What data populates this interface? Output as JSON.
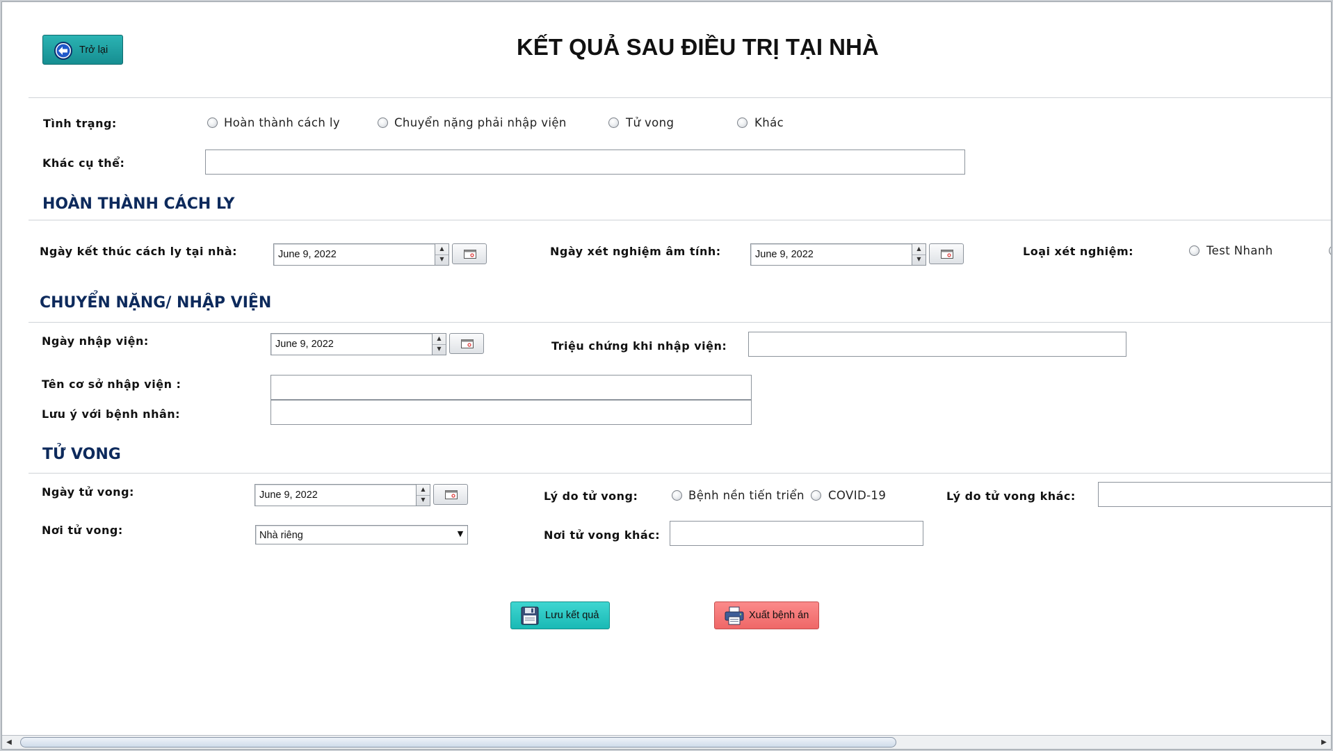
{
  "header": {
    "back_button": "Trở lại",
    "title": "KẾT QUẢ SAU ĐIỀU TRỊ TẠI NHÀ"
  },
  "status": {
    "label": "Tình trạng:",
    "options": [
      "Hoàn thành cách ly",
      "Chuyển nặng phải nhập viện",
      "Tử vong",
      "Khác"
    ],
    "other_label": "Khác cụ thể:",
    "other_value": ""
  },
  "quarantine": {
    "heading": "HOÀN THÀNH CÁCH LY",
    "end_date_label": "Ngày kết thúc cách ly tại nhà:",
    "end_date": "June 9, 2022",
    "negative_date_label": "Ngày xét nghiệm âm tính:",
    "negative_date": "June 9, 2022",
    "test_type_label": "Loại xét nghiệm:",
    "test_options": [
      "Test Nhanh"
    ]
  },
  "hospital": {
    "heading": "CHUYỂN NẶNG/ NHẬP VIỆN",
    "admit_date_label": "Ngày nhập viện:",
    "admit_date": "June 9, 2022",
    "symptoms_label": "Triệu chứng khi nhập viện:",
    "symptoms_value": "",
    "facility_label": "Tên cơ sở nhập viện :",
    "facility_value": "",
    "note_label": "Lưu ý với bệnh nhân:",
    "note_value": ""
  },
  "death": {
    "heading": "TỬ VONG",
    "date_label": "Ngày tử vong:",
    "date": "June 9, 2022",
    "reason_label": "Lý do tử vong:",
    "reason_options": [
      "Bệnh nền tiến triển",
      "COVID-19"
    ],
    "other_reason_label": "Lý do tử vong khác:",
    "other_reason_value": "",
    "place_label": "Nơi tử vong:",
    "place_value": "Nhà riêng",
    "other_place_label": "Nơi tử vong khác:",
    "other_place_value": ""
  },
  "actions": {
    "save": "Lưu kết quả",
    "export": "Xuất bệnh án"
  },
  "colors": {
    "section_heading": "#0d2a5c",
    "back_button": "#1aa3a3",
    "save_button": "#22c9c4",
    "export_button": "#f47a7a"
  }
}
